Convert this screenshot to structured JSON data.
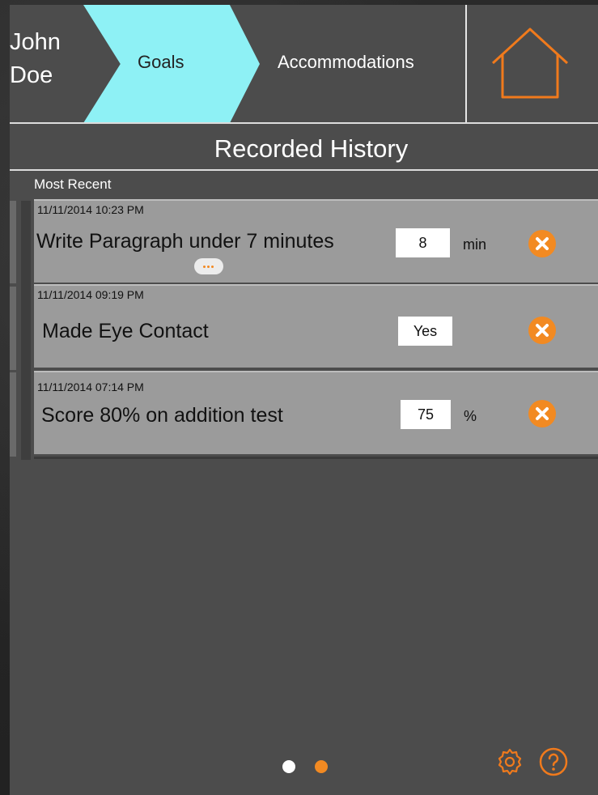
{
  "header": {
    "student_name": "John\nDoe",
    "tabs": [
      {
        "label": "Goals",
        "active": true
      },
      {
        "label": "Accommodations",
        "active": false
      }
    ],
    "home_icon": "home-icon"
  },
  "history": {
    "title": "Recorded History",
    "subtitle": "Most Recent",
    "entries": [
      {
        "timestamp": "11/11/2014 10:23 PM",
        "goal": "Write Paragraph under 7 minutes",
        "value": "8",
        "unit": "min"
      },
      {
        "timestamp": "11/11/2014 09:19 PM",
        "goal": "Made Eye Contact",
        "value": "Yes",
        "unit": ""
      },
      {
        "timestamp": "11/11/2014 07:14 PM",
        "goal": "Score 80% on addition test",
        "value": "75",
        "unit": "%"
      }
    ]
  },
  "pager": {
    "page_count": 2,
    "current_page": 2
  },
  "footer": {
    "icons": [
      "settings-icon",
      "help-icon"
    ]
  },
  "colors": {
    "accent": "#f28a22",
    "active_tab": "#8ef1f5",
    "panel": "#4c4c4c",
    "entry_bg": "#9b9b9b"
  }
}
